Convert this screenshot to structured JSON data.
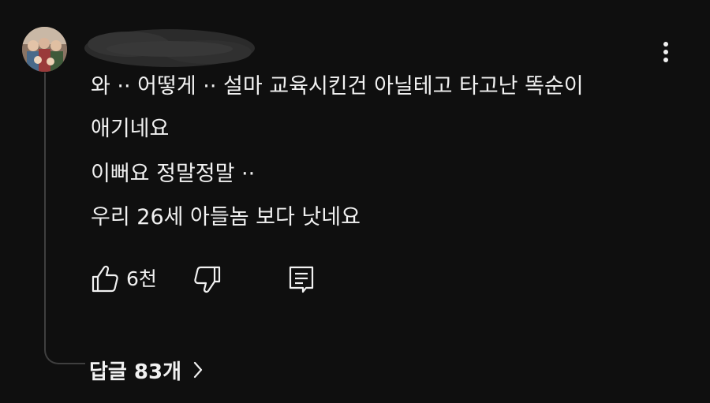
{
  "comment": {
    "lines": [
      "와 ·· 어떻게 ·· 설마 교육시킨건 아닐테고 타고난 똑순이",
      "애기네요",
      "이뻐요 정말정말 ··",
      "우리 26세 아들놈 보다 낫네요"
    ]
  },
  "actions": {
    "like_count": "6천"
  },
  "replies": {
    "label": "답글 83개"
  },
  "icons": {
    "more": "vertical-dots-icon",
    "like": "thumbs-up-icon",
    "dislike": "thumbs-down-icon",
    "reply": "comment-reply-icon",
    "chevron": "chevron-right-icon"
  },
  "colors": {
    "background": "#0f0f0f",
    "text": "#f1f1f1",
    "thread_line": "#3f3f3f"
  }
}
